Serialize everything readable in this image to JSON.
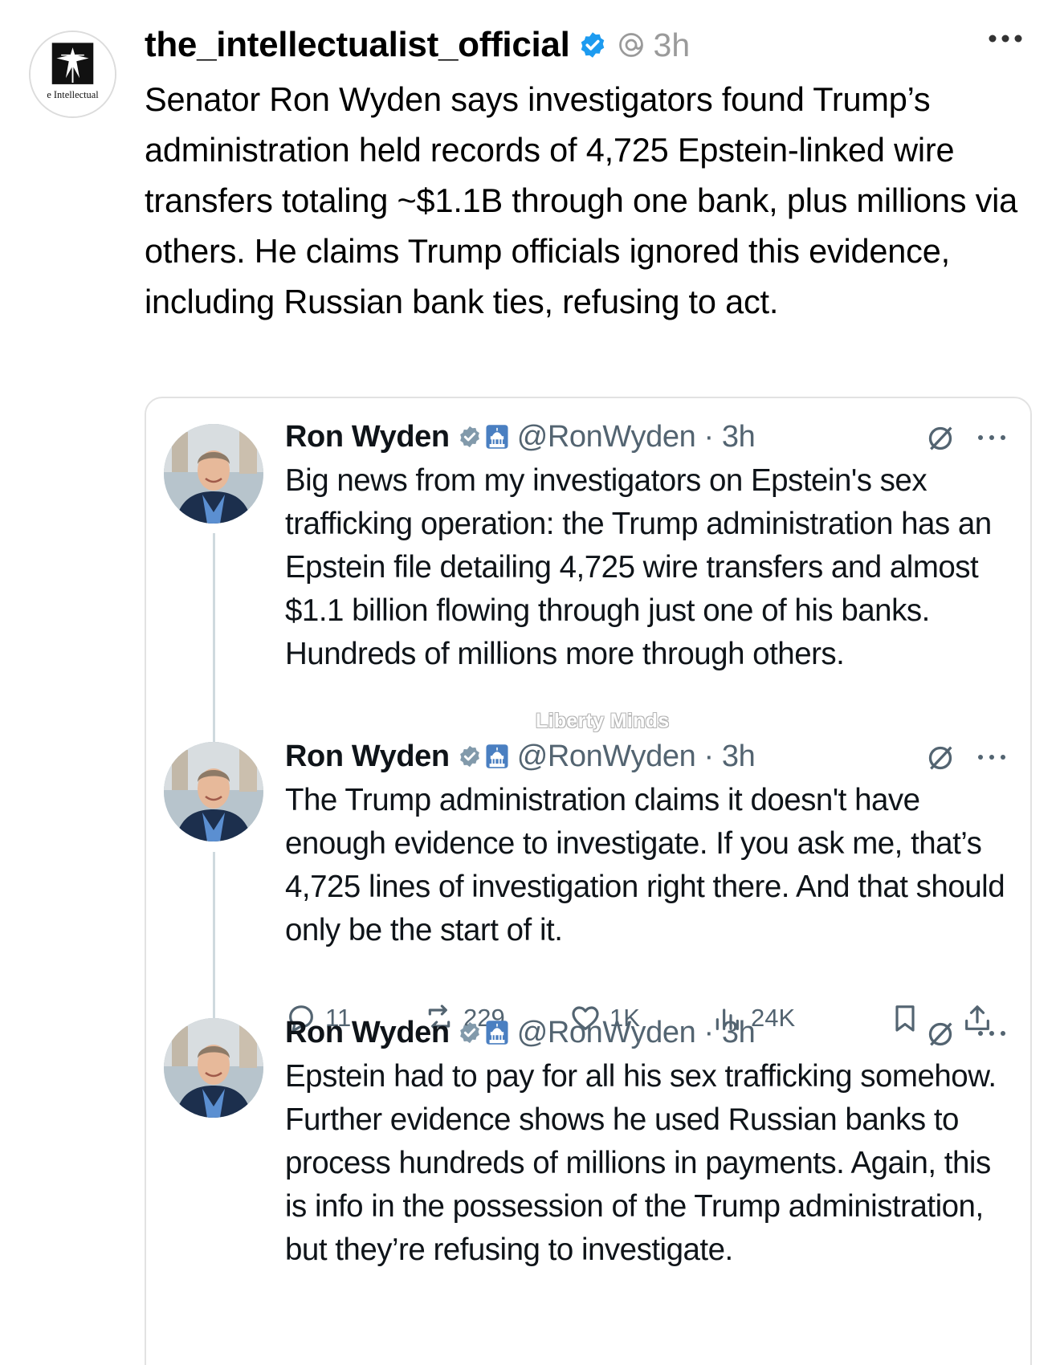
{
  "post": {
    "username": "the_intellectualist_official",
    "time": "3h",
    "avatar_text": "e Intellectual",
    "caption": "Senator Ron Wyden says investigators found Trump’s administration held records of 4,725 Epstein-linked wire transfers totaling ~$1.1B through one bank, plus millions via others. He claims Trump officials ignored this evidence, including Russian bank ties, refusing to act."
  },
  "embed": {
    "watermark": "Liberty Minds",
    "tweets": [
      {
        "name": "Ron Wyden",
        "handle": "@RonWyden · 3h",
        "text": "Big news from my investigators on Epstein's sex trafficking operation: the Trump administration has an Epstein file detailing 4,725 wire transfers and almost $1.1 billion flowing through just one of his banks. Hundreds of millions more through others."
      },
      {
        "name": "Ron Wyden",
        "handle": "@RonWyden · 3h",
        "text": "The Trump administration claims it doesn't have enough evidence to investigate. If you ask me, that’s 4,725 lines of investigation right there. And that should only be the start of it.",
        "stats": {
          "replies": "11",
          "reposts": "229",
          "likes": "1K",
          "views": "24K"
        }
      },
      {
        "name": "Ron Wyden",
        "handle": "@RonWyden · 3h",
        "text": "Epstein had to pay for all his sex trafficking somehow. Further evidence shows he used Russian banks to process hundreds of millions in payments. Again, this is info in the possession of the Trump administration, but they’re refusing to investigate."
      }
    ]
  },
  "colors": {
    "verified_blue": "#1d9bf0",
    "muted_text": "#536471",
    "gold_badge": "#829aab"
  }
}
